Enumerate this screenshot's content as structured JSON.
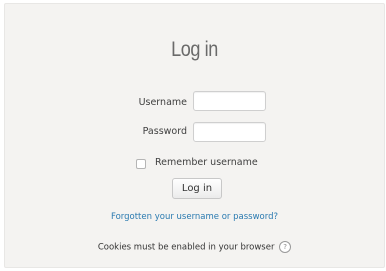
{
  "login": {
    "title": "Log in",
    "username_label": "Username",
    "username_value": "",
    "password_label": "Password",
    "password_value": "",
    "remember_label": "Remember username",
    "remember_checked": false,
    "submit_label": "Log in",
    "forgot_link": "Forgotten your username or password?",
    "cookies_notice": "Cookies must be enabled in your browser",
    "help_icon": "question-mark-circle-icon",
    "help_glyph": "?"
  },
  "colors": {
    "panel_background": "#f4f3f1",
    "title": "#6a6a6a",
    "link": "#2a7ab0"
  }
}
